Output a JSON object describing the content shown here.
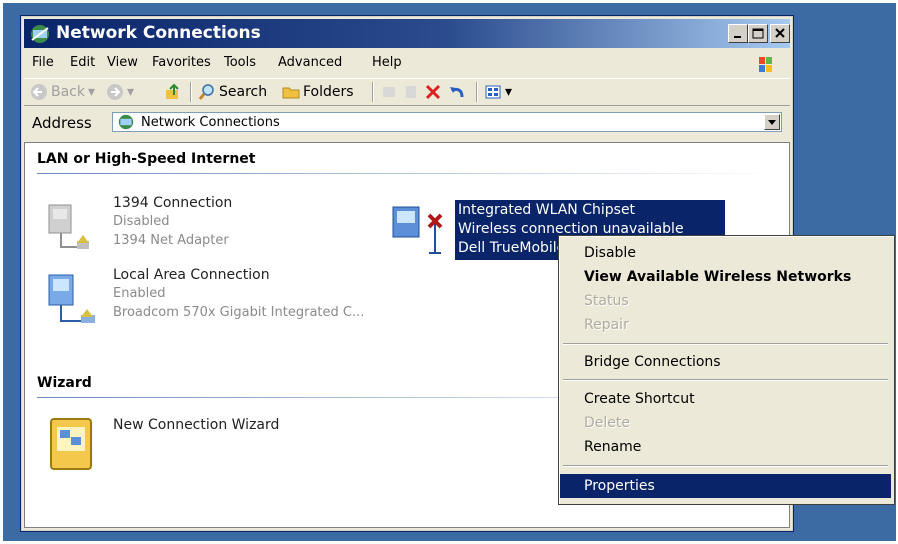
{
  "window": {
    "title": "Network Connections",
    "icon": "network-connections-icon",
    "controls": [
      "minimize-icon",
      "maximize-icon",
      "close-icon"
    ]
  },
  "menubar": {
    "items": [
      "File",
      "Edit",
      "View",
      "Favorites",
      "Tools",
      "Advanced",
      "Help"
    ]
  },
  "toolbar": {
    "back": "Back",
    "search": "Search",
    "folders": "Folders"
  },
  "address": {
    "label": "Address",
    "value": "Network Connections"
  },
  "groups": {
    "lan": {
      "heading": "LAN or High-Speed Internet",
      "items": [
        {
          "name": "1394 Connection",
          "status": "Disabled",
          "device": "1394 Net Adapter"
        },
        {
          "name": "Local Area Connection",
          "status": "Enabled",
          "device": "Broadcom 570x Gigabit Integrated C..."
        }
      ],
      "selected": {
        "name": "Integrated WLAN Chipset",
        "status": "Wireless connection unavailable",
        "device": "Dell TrueMobile"
      }
    },
    "wizard": {
      "heading": "Wizard",
      "items": [
        {
          "name": "New Connection Wizard"
        }
      ]
    }
  },
  "context_menu": {
    "items": [
      {
        "label": "Disable",
        "state": "enabled"
      },
      {
        "label": "View Available Wireless Networks",
        "state": "default"
      },
      {
        "label": "Status",
        "state": "disabled"
      },
      {
        "label": "Repair",
        "state": "disabled"
      },
      {
        "label": "Bridge Connections",
        "state": "enabled"
      },
      {
        "label": "Create Shortcut",
        "state": "enabled"
      },
      {
        "label": "Delete",
        "state": "disabled"
      },
      {
        "label": "Rename",
        "state": "enabled"
      },
      {
        "label": "Properties",
        "state": "highlighted"
      }
    ]
  },
  "colors": {
    "desktop": "#3c6aa3",
    "titlebar": "#0a246a",
    "selection": "#0a246a",
    "window_face": "#ece9d8"
  }
}
